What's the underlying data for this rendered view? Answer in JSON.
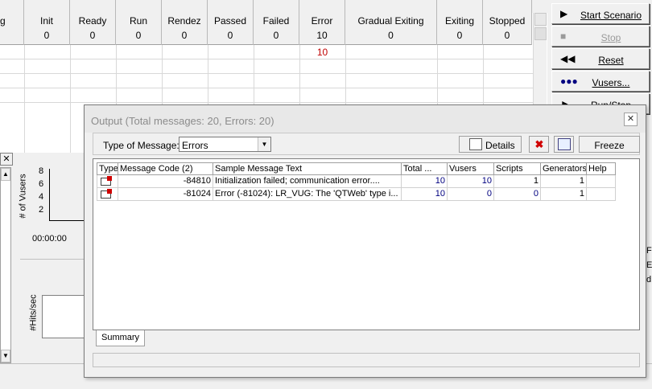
{
  "status_grid": {
    "columns": [
      {
        "label": "g",
        "value": ""
      },
      {
        "label": "Init",
        "value": "0"
      },
      {
        "label": "Ready",
        "value": "0"
      },
      {
        "label": "Run",
        "value": "0"
      },
      {
        "label": "Rendez",
        "value": "0"
      },
      {
        "label": "Passed",
        "value": "0"
      },
      {
        "label": "Failed",
        "value": "0"
      },
      {
        "label": "Error",
        "value": "10"
      },
      {
        "label": "Gradual Exiting",
        "value": "0"
      },
      {
        "label": "Exiting",
        "value": "0"
      },
      {
        "label": "Stopped",
        "value": "0"
      }
    ],
    "error_row_value": "10"
  },
  "scenario_buttons": {
    "start": "Start Scenario",
    "stop": "Stop",
    "reset": "Reset",
    "vusers": "Vusers...",
    "run_stop": "Run/Stop Vusers"
  },
  "vusers_graph": {
    "ylabel": "# of Vusers",
    "ticks": [
      "8",
      "6",
      "4",
      "2"
    ],
    "time": "00:00:00"
  },
  "hits_graph": {
    "ylabel": "#Hits/sec"
  },
  "right_edge_text": [
    "F",
    "E",
    "d"
  ],
  "output_dialog": {
    "title": "Output (Total messages: 20,  Errors: 20)",
    "type_label": "Type of Message:",
    "type_value": "Errors",
    "details_button": "Details",
    "freeze_button": "Freeze",
    "columns": [
      "Type",
      "Message Code (2)",
      "Sample Message Text",
      "Total ...",
      "Vusers",
      "Scripts",
      "Generators",
      "Help"
    ],
    "rows": [
      {
        "code": "-84810",
        "text": "Initialization failed; communication error....",
        "total": "10",
        "vusers": "10",
        "scripts": "1",
        "generators": "1"
      },
      {
        "code": "-81024",
        "text": "Error (-81024): LR_VUG: The 'QTWeb' type i...",
        "total": "10",
        "vusers": "0",
        "scripts": "0",
        "generators": "1"
      }
    ],
    "tab": "Summary"
  }
}
